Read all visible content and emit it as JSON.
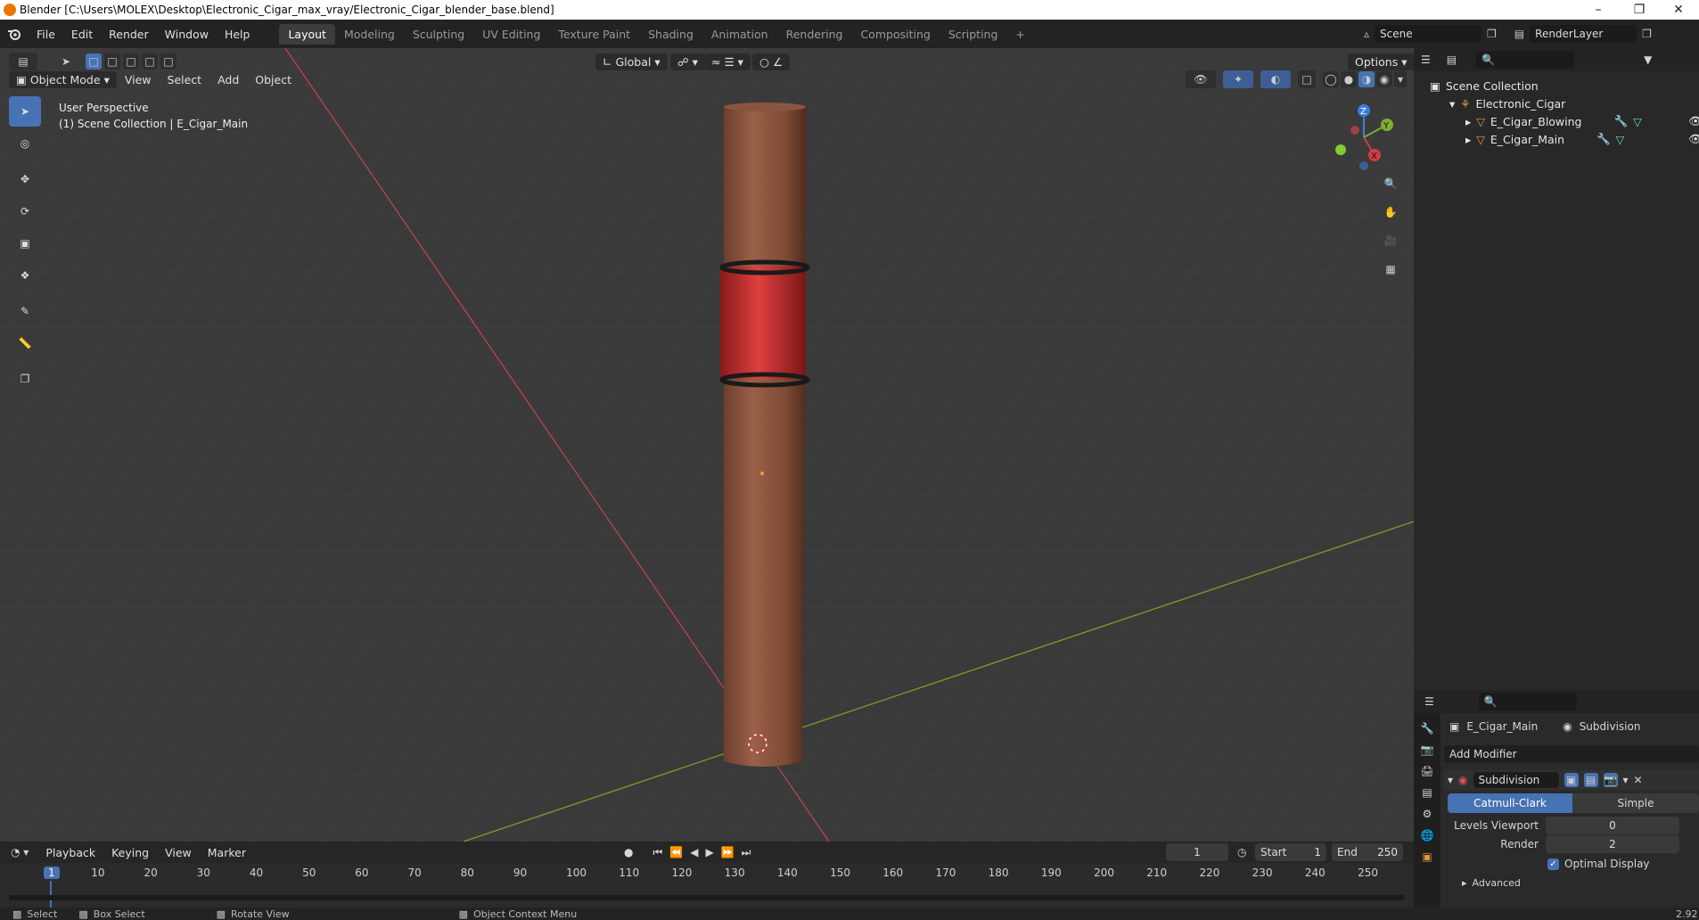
{
  "window": {
    "title": "Blender [C:\\Users\\MOLEX\\Desktop\\Electronic_Cigar_max_vray/Electronic_Cigar_blender_base.blend]",
    "min": "–",
    "max": "❐",
    "close": "✕"
  },
  "menus": [
    "File",
    "Edit",
    "Render",
    "Window",
    "Help"
  ],
  "workspaces": [
    "Layout",
    "Modeling",
    "Sculpting",
    "UV Editing",
    "Texture Paint",
    "Shading",
    "Animation",
    "Rendering",
    "Compositing",
    "Scripting"
  ],
  "workspace_add": "+",
  "scene": {
    "name": "Scene",
    "layer": "RenderLayer"
  },
  "viewport": {
    "transform_orientation": "Global",
    "options_label": "Options",
    "mode": "Object Mode",
    "menus": [
      "View",
      "Select",
      "Add",
      "Object"
    ],
    "overlay_line1": "User Perspective",
    "overlay_line2": "(1) Scene Collection | E_Cigar_Main",
    "gizmo": {
      "z": "Z",
      "y": "Y",
      "x": "X"
    }
  },
  "outliner": {
    "items": [
      {
        "label": "Scene Collection"
      },
      {
        "label": "Electronic_Cigar"
      },
      {
        "label": "E_Cigar_Blowing"
      },
      {
        "label": "E_Cigar_Main"
      }
    ]
  },
  "properties": {
    "object": "E_Cigar_Main",
    "modifier_tab": "Subdivision",
    "add_modifier": "Add Modifier",
    "modifier_name": "Subdivision",
    "mode_a": "Catmull-Clark",
    "mode_b": "Simple",
    "levels_label": "Levels Viewport",
    "levels_value": "0",
    "render_label": "Render",
    "render_value": "2",
    "optimal_label": "Optimal Display",
    "advanced_label": "Advanced"
  },
  "timeline": {
    "menus": [
      "Playback",
      "Keying",
      "View",
      "Marker"
    ],
    "current_frame": "1",
    "start_label": "Start",
    "start_value": "1",
    "end_label": "End",
    "end_value": "250",
    "ticks": [
      "1",
      "10",
      "20",
      "30",
      "40",
      "50",
      "60",
      "70",
      "80",
      "90",
      "100",
      "110",
      "120",
      "130",
      "140",
      "150",
      "160",
      "170",
      "180",
      "190",
      "200",
      "210",
      "220",
      "230",
      "240",
      "250"
    ]
  },
  "status": {
    "select": "Select",
    "box_select": "Box Select",
    "rotate": "Rotate View",
    "context": "Object Context Menu",
    "version": "2.92"
  },
  "colors": {
    "accent": "#4772b3",
    "x_axis": "#d43b47",
    "y_axis": "#7fae2e",
    "z_axis": "#3c7ee0"
  }
}
